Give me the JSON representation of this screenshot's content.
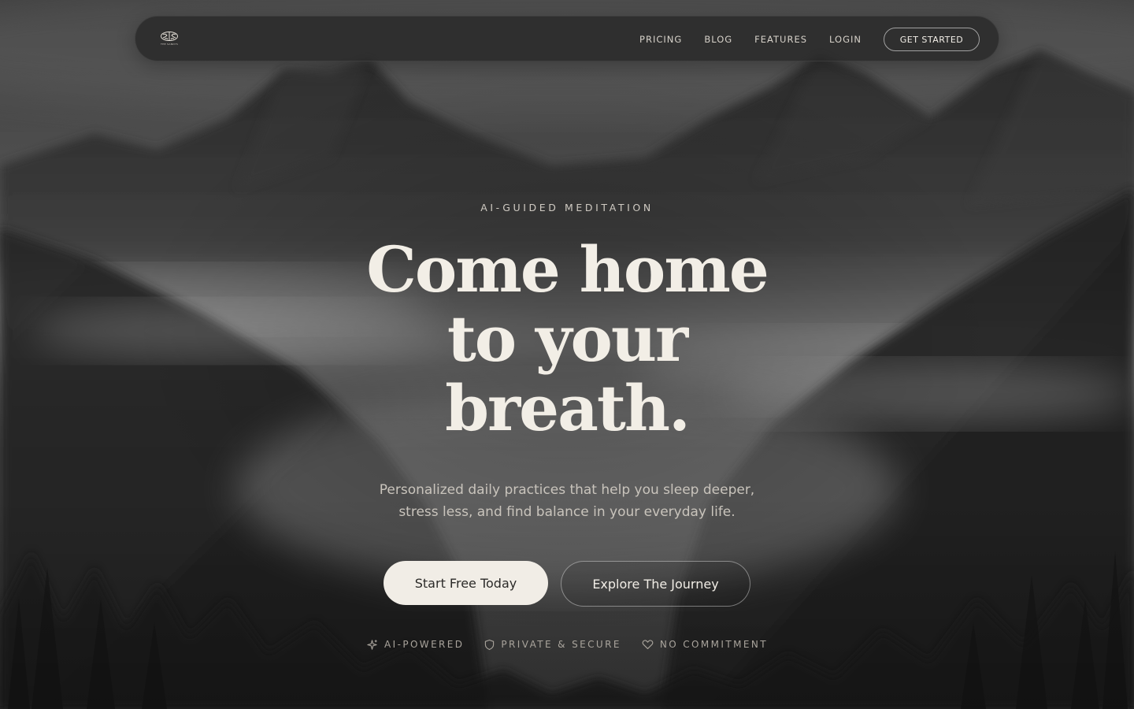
{
  "brand": {
    "logo_icon": "brain-icon",
    "logo_text": "THE SANDYS"
  },
  "nav": {
    "links": [
      {
        "label": "PRICING"
      },
      {
        "label": "BLOG"
      },
      {
        "label": "FEATURES"
      },
      {
        "label": "LOGIN"
      }
    ],
    "cta_label": "GET STARTED"
  },
  "hero": {
    "eyebrow": "AI-GUIDED MEDITATION",
    "headline_lines": [
      "Come home",
      "to your",
      "breath."
    ],
    "subtitle_lines": [
      "Personalized daily practices that help you sleep deeper,",
      "stress less, and find balance in your everyday life."
    ],
    "primary_cta": "Start Free Today",
    "secondary_cta": "Explore The Journey"
  },
  "features": [
    {
      "icon": "sparkle-icon",
      "label": "AI-POWERED"
    },
    {
      "icon": "shield-icon",
      "label": "PRIVATE & SECURE"
    },
    {
      "icon": "heart-icon",
      "label": "NO COMMITMENT"
    }
  ],
  "colors": {
    "text_primary": "#f1ede6",
    "button_primary_bg": "#f1ede6",
    "button_primary_text": "#2b2a28",
    "nav_bg": "#282828"
  }
}
